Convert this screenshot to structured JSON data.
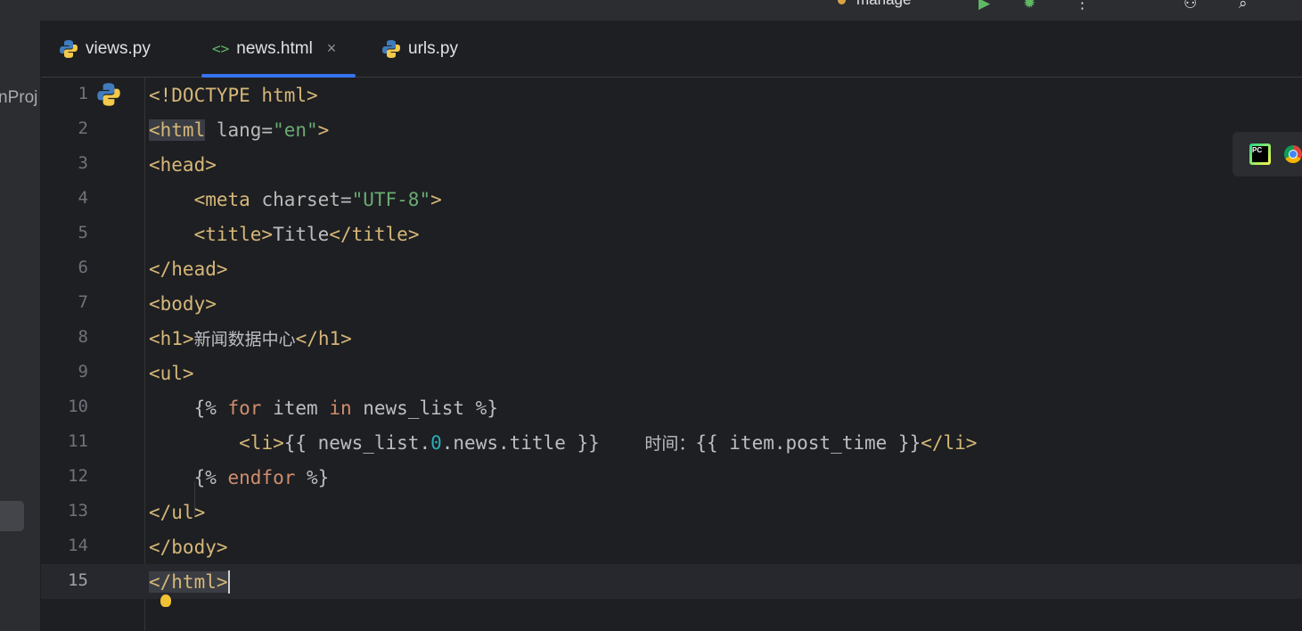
{
  "window": {
    "run_config": "manage",
    "icons": [
      "run-icon",
      "debug-icon",
      "more-icon",
      "add-user-icon",
      "search-icon"
    ]
  },
  "project_panel": {
    "label": "nProj"
  },
  "tabs": [
    {
      "label": "views.py",
      "icon": "python-file-icon",
      "active": false
    },
    {
      "label": "news.html",
      "icon": "html-file-icon",
      "active": true,
      "close": "×"
    },
    {
      "label": "urls.py",
      "icon": "python-file-icon",
      "active": false
    }
  ],
  "editor": {
    "current_line": 15,
    "line_numbers": [
      "1",
      "2",
      "3",
      "4",
      "5",
      "6",
      "7",
      "8",
      "9",
      "10",
      "11",
      "12",
      "13",
      "14",
      "15"
    ],
    "lines": {
      "l1": {
        "t1": "<!DOCTYPE html>"
      },
      "l2": {
        "t1": "<html",
        "t2": " lang=",
        "t3": "\"en\"",
        "t4": ">"
      },
      "l3": {
        "t1": "<head>"
      },
      "l4": {
        "t0": "    ",
        "t1": "<meta",
        "t2": " charset=",
        "t3": "\"UTF-8\"",
        "t4": ">"
      },
      "l5": {
        "t0": "    ",
        "t1": "<title>",
        "t2": "Title",
        "t3": "</title>"
      },
      "l6": {
        "t1": "</head>"
      },
      "l7": {
        "t1": "<body>"
      },
      "l8": {
        "t1": "<h1>",
        "t2": "新闻数据中心",
        "t3": "</h1>"
      },
      "l9": {
        "t1": "<ul>"
      },
      "l10": {
        "t0": "    {% ",
        "t1": "for",
        "t2": " item ",
        "t3": "in",
        "t4": " news_list %}"
      },
      "l11": {
        "t0": "        ",
        "t1": "<li>",
        "t2": "{{ news_list.",
        "t3": "0",
        "t4": ".news.title }}    ",
        "t5": "时间：",
        "t6": "{{ item.post_time }}",
        "t7": "</li>"
      },
      "l12": {
        "t0": "    {% ",
        "t1": "endfor",
        "t2": " %}"
      },
      "l13": {
        "t1": "</ul>"
      },
      "l14": {
        "t1": "</body>"
      },
      "l15": {
        "t1": "</html>"
      }
    }
  },
  "browser_icons": [
    "pycharm-icon",
    "chrome-icon"
  ],
  "colors": {
    "accent": "#3574f0",
    "tag": "#d5b778",
    "string": "#6aab73",
    "keyword": "#cf8e6d",
    "number": "#2aacb8"
  }
}
